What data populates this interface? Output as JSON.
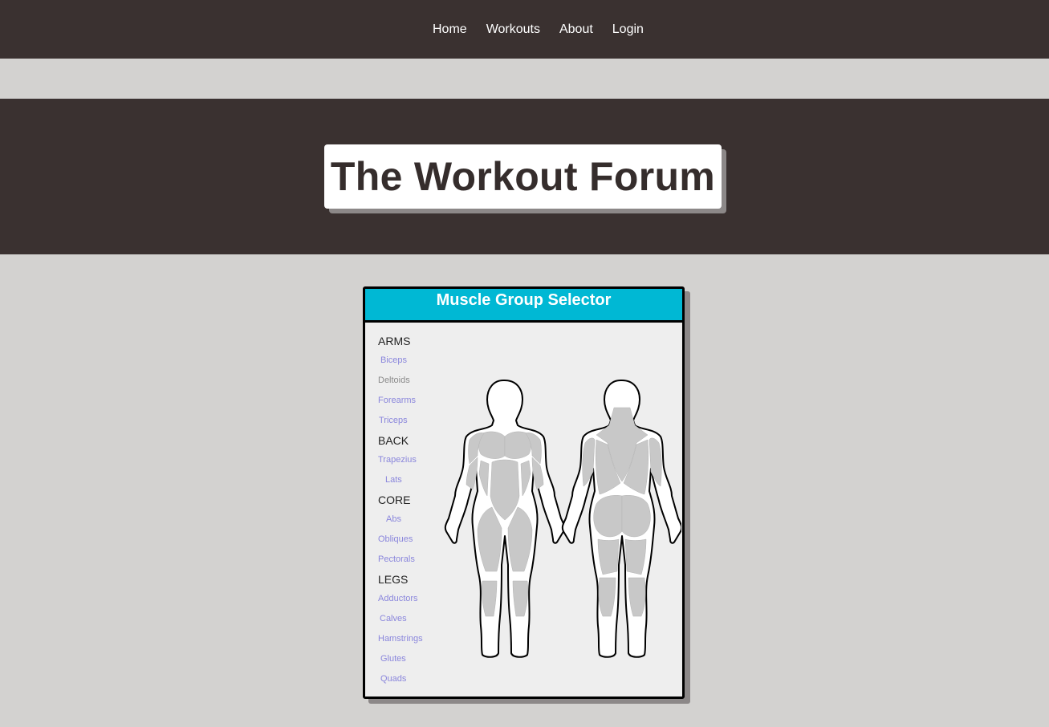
{
  "nav": {
    "links": [
      {
        "label": "Home"
      },
      {
        "label": "Workouts"
      },
      {
        "label": "About"
      },
      {
        "label": "Login"
      }
    ]
  },
  "hero": {
    "title": "The Workout Forum"
  },
  "selector": {
    "title": "Muscle Group Selector",
    "groups": [
      {
        "name": "ARMS",
        "muscles": [
          "Biceps",
          "Deltoids",
          "Forearms",
          "Triceps"
        ]
      },
      {
        "name": "BACK",
        "muscles": [
          "Trapezius",
          "Lats"
        ]
      },
      {
        "name": "CORE",
        "muscles": [
          "Abs",
          "Obliques",
          "Pectorals"
        ]
      },
      {
        "name": "LEGS",
        "muscles": [
          "Adductors",
          "Calves",
          "Hamstrings",
          "Glutes",
          "Quads"
        ]
      }
    ],
    "colors": {
      "header": "#00b8d4",
      "link": "#8a86dc",
      "muscle_fill": "#c8c8c8"
    }
  }
}
